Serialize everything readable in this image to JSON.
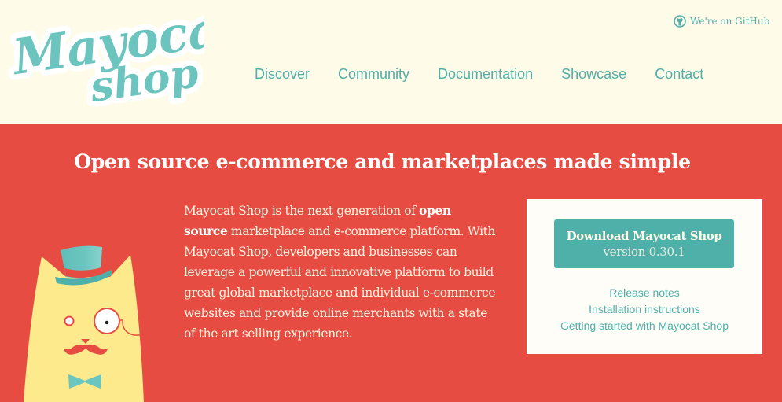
{
  "header": {
    "logo_text": [
      "Mayocat",
      "shop"
    ],
    "github_label": "We're on GitHub",
    "nav": [
      {
        "label": "Discover"
      },
      {
        "label": "Community"
      },
      {
        "label": "Documentation"
      },
      {
        "label": "Showcase"
      },
      {
        "label": "Contact"
      }
    ]
  },
  "hero": {
    "title": "Open source e-commerce and marketplaces made simple",
    "description": {
      "before_bold": "Mayocat Shop is the next generation of ",
      "bold": "open source",
      "after_bold": " marketplace and e-commerce platform. With Mayocat Shop, developers and businesses can leverage a powerful and innovative platform to build great global marketplace and individual e-commerce websites and provide online merchants with a state of the art selling experience."
    }
  },
  "download_card": {
    "button_title": "Download Mayocat Shop",
    "button_version": "version 0.30.1",
    "links": [
      {
        "label": "Release notes"
      },
      {
        "label": "Installation instructions"
      },
      {
        "label": "Getting started with Mayocat Shop"
      }
    ]
  },
  "colors": {
    "header_bg": "#fefbe8",
    "hero_bg": "#e64c41",
    "accent_teal": "#4fafa9",
    "card_bg": "#fefdf7",
    "cat_yellow": "#fdea8c"
  }
}
